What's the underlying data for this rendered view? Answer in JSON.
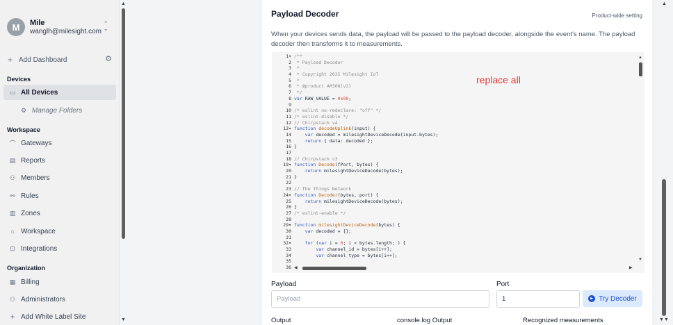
{
  "sidebar": {
    "user": {
      "initial": "M",
      "name": "Mile",
      "email": "wanglh@milesight.com"
    },
    "add_dashboard": "Add Dashboard",
    "devices_heading": "Devices",
    "all_devices": "All Devices",
    "manage_folders": "Manage Folders",
    "workspace_heading": "Workspace",
    "workspace_items": [
      {
        "label": "Gateways",
        "icon": "gateway-icon"
      },
      {
        "label": "Reports",
        "icon": "report-icon"
      },
      {
        "label": "Members",
        "icon": "members-icon"
      },
      {
        "label": "Rules",
        "icon": "rules-icon"
      },
      {
        "label": "Zones",
        "icon": "zones-icon"
      },
      {
        "label": "Workspace",
        "icon": "workspace-icon"
      },
      {
        "label": "Integrations",
        "icon": "integrations-icon"
      }
    ],
    "organization_heading": "Organization",
    "organization_items": [
      {
        "label": "Billing",
        "icon": "billing-icon"
      },
      {
        "label": "Administrators",
        "icon": "administrators-icon"
      },
      {
        "label": "Add White Label Site",
        "icon": "plus-icon"
      }
    ]
  },
  "panel": {
    "title": "Payload Decoder",
    "setting_scope": "Product-wide setting",
    "description": "When your devices sends data, the payload will be passed to the payload decoder, alongside the event's name. The payload decoder then transforms it to measurements.",
    "annotation": "replace all",
    "line_numbers": [
      "1",
      "2",
      "3",
      "4",
      "5",
      "6",
      "7",
      "8",
      "9",
      "10",
      "11",
      "12",
      "13",
      "14",
      "15",
      "16",
      "17",
      "18",
      "19",
      "20",
      "21",
      "22",
      "23",
      "24",
      "25",
      "26",
      "27",
      "28",
      "29",
      "30",
      "31",
      "32",
      "33",
      "34",
      "35",
      "36"
    ],
    "code_lines": [
      "/**",
      " * Payload Decoder",
      " *",
      " * Copyright 2025 Milesight IoT",
      " *",
      " * @product AM308(v2)",
      " */",
      "var RAW_VALUE = 0x00;",
      "",
      "/* eslint no-redeclare: \"off\" */",
      "/* eslint-disable */",
      "// Chirpstack v4",
      "function decodeUplink(input) {",
      "    var decoded = milesightDeviceDecode(input.bytes);",
      "    return { data: decoded };",
      "}",
      "",
      "// Chirpstack v3",
      "function Decode(fPort, bytes) {",
      "    return milesightDeviceDecode(bytes);",
      "}",
      "",
      "// The Things Network",
      "function Decoder(bytes, port) {",
      "    return milesightDeviceDecode(bytes);",
      "}",
      "/* eslint-enable */",
      "",
      "function milesightDeviceDecode(bytes) {",
      "    var decoded = {};",
      "",
      "    for (var i = 0; i < bytes.length; ) {",
      "        var channel_id = bytes[i++];",
      "        var channel_type = bytes[i++];",
      "",
      ""
    ],
    "payload_label": "Payload",
    "payload_placeholder": "Payload",
    "port_label": "Port",
    "port_value": "1",
    "try_button": "Try Decoder",
    "output_label": "Output",
    "console_label": "console.log Output",
    "measurements_label": "Recognized measurements"
  },
  "colors": {
    "accent": "#1d4ed8",
    "accent_bg": "#dbeafe",
    "annotation": "#e53935",
    "sidebar_bg": "#f1f1f1",
    "active_item_bg": "#dfe1e5"
  }
}
